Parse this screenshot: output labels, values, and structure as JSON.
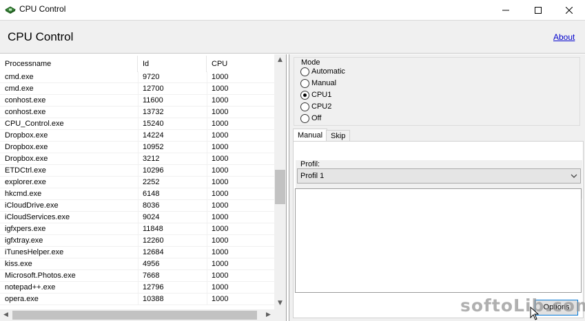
{
  "window": {
    "title": "CPU Control"
  },
  "header": {
    "title": "CPU Control",
    "about_link": "About"
  },
  "process_table": {
    "columns": [
      "Processname",
      "Id",
      "CPU"
    ],
    "rows": [
      [
        "cmd.exe",
        "9720",
        "1000"
      ],
      [
        "cmd.exe",
        "12700",
        "1000"
      ],
      [
        "conhost.exe",
        "11600",
        "1000"
      ],
      [
        "conhost.exe",
        "13732",
        "1000"
      ],
      [
        "CPU_Control.exe",
        "15240",
        "1000"
      ],
      [
        "Dropbox.exe",
        "14224",
        "1000"
      ],
      [
        "Dropbox.exe",
        "10952",
        "1000"
      ],
      [
        "Dropbox.exe",
        "3212",
        "1000"
      ],
      [
        "ETDCtrl.exe",
        "10296",
        "1000"
      ],
      [
        "explorer.exe",
        "2252",
        "1000"
      ],
      [
        "hkcmd.exe",
        "6148",
        "1000"
      ],
      [
        "iCloudDrive.exe",
        "8036",
        "1000"
      ],
      [
        "iCloudServices.exe",
        "9024",
        "1000"
      ],
      [
        "igfxpers.exe",
        "11848",
        "1000"
      ],
      [
        "igfxtray.exe",
        "12260",
        "1000"
      ],
      [
        "iTunesHelper.exe",
        "12684",
        "1000"
      ],
      [
        "kiss.exe",
        "4956",
        "1000"
      ],
      [
        "Microsoft.Photos.exe",
        "7668",
        "1000"
      ],
      [
        "notepad++.exe",
        "12796",
        "1000"
      ],
      [
        "opera.exe",
        "10388",
        "1000"
      ]
    ]
  },
  "mode": {
    "label": "Mode",
    "options": [
      "Automatic",
      "Manual",
      "CPU1",
      "CPU2",
      "Off"
    ],
    "selected": "CPU1"
  },
  "tabs": {
    "items": [
      "Manual",
      "Skip"
    ],
    "active": "Manual"
  },
  "profil": {
    "label": "Profil:",
    "selected": "Profil 1"
  },
  "options_button": "Options",
  "watermark": "softoLib.com",
  "icons": {
    "app": "chip-icon",
    "minimize": "minimize-icon",
    "maximize": "maximize-icon",
    "close": "close-icon"
  }
}
